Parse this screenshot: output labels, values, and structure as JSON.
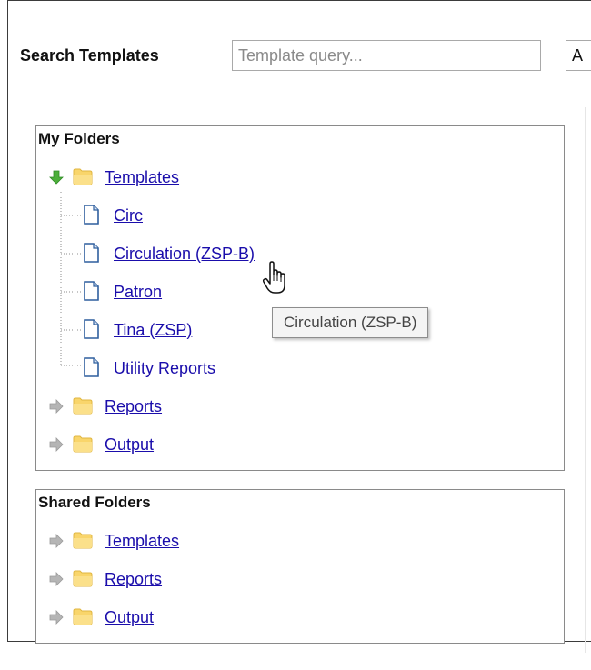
{
  "search": {
    "label": "Search Templates",
    "placeholder": "Template query...",
    "button_label": "A"
  },
  "my_folders": {
    "title": "My Folders",
    "items": [
      {
        "label": "Templates",
        "expanded": true,
        "arrow": "green-down-arrow-icon",
        "icon": "folder-icon"
      },
      {
        "label": "Reports",
        "expanded": false,
        "arrow": "gray-right-arrow-icon",
        "icon": "folder-icon"
      },
      {
        "label": "Output",
        "expanded": false,
        "arrow": "gray-right-arrow-icon",
        "icon": "folder-icon"
      }
    ],
    "template_children": [
      {
        "label": "Circ",
        "icon": "document-icon"
      },
      {
        "label": "Circulation (ZSP-B)",
        "icon": "document-icon",
        "hovered": true
      },
      {
        "label": "Patron",
        "icon": "document-icon"
      },
      {
        "label": "Tina (ZSP)",
        "icon": "document-icon"
      },
      {
        "label": "Utility Reports",
        "icon": "document-icon"
      }
    ]
  },
  "shared_folders": {
    "title": "Shared Folders",
    "items": [
      {
        "label": "Templates",
        "expanded": false,
        "arrow": "gray-right-arrow-icon",
        "icon": "folder-icon"
      },
      {
        "label": "Reports",
        "expanded": false,
        "arrow": "gray-right-arrow-icon",
        "icon": "folder-icon"
      },
      {
        "label": "Output",
        "expanded": false,
        "arrow": "gray-right-arrow-icon",
        "icon": "folder-icon"
      }
    ]
  },
  "tooltip": {
    "text": "Circulation (ZSP-B)"
  },
  "colors": {
    "link": "#1a0dab",
    "folder": "#f7c948",
    "arrow_green": "#4caf3a",
    "arrow_gray": "#b5b5b5",
    "doc_border": "#2f5f9e"
  }
}
